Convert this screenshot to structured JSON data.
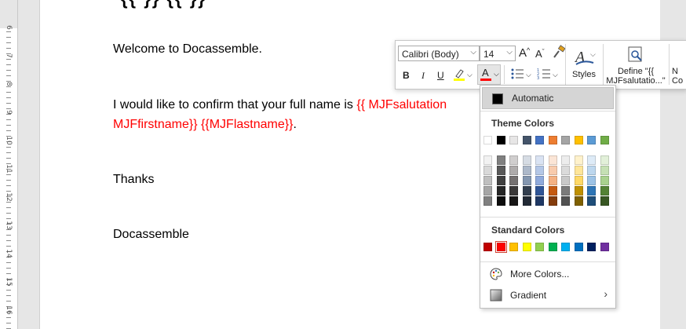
{
  "document": {
    "top_clipped": "{{ }} {{ }}",
    "line1": "Welcome to Docassemble.",
    "line2_plain": "I would like to confirm that your full name is ",
    "line2_red": "{{ MJFsalutation",
    "line3_red": "MJFfirstname}} {{MJFlastname}}",
    "line3_end": ".",
    "line4": "Thanks",
    "line5": "Docassemble"
  },
  "ruler": {
    "numbers": [
      "6",
      "7",
      "8",
      "9",
      "10",
      "11",
      "12",
      "13",
      "14",
      "15",
      "16"
    ]
  },
  "mini_toolbar": {
    "font_name": "Calibri (Body)",
    "font_size": "14",
    "grow_font": "A",
    "shrink_font": "A",
    "bold": "B",
    "italic": "I",
    "underline": "U",
    "font_color_glyph": "A",
    "styles_label": "Styles",
    "define_label_line1": "Define \"{{",
    "define_label_line2": "MJFsalutatio...\"",
    "partial_label_line1": "N",
    "partial_label_line2": "Co"
  },
  "color_menu": {
    "automatic": "Automatic",
    "theme_header": "Theme Colors",
    "standard_header": "Standard Colors",
    "more_colors": "More Colors...",
    "gradient": "Gradient",
    "theme_top": [
      "#ffffff",
      "#000000",
      "#e7e6e6",
      "#44546a",
      "#4472c4",
      "#ed7d31",
      "#a5a5a5",
      "#ffc000",
      "#5b9bd5",
      "#70ad47"
    ],
    "theme_shades": [
      [
        "#f2f2f2",
        "#d9d9d9",
        "#bfbfbf",
        "#a6a6a6",
        "#808080"
      ],
      [
        "#808080",
        "#595959",
        "#404040",
        "#262626",
        "#0d0d0d"
      ],
      [
        "#d0cece",
        "#aeabab",
        "#757171",
        "#3a3838",
        "#171616"
      ],
      [
        "#d6dce4",
        "#adb9ca",
        "#8497b0",
        "#333f4f",
        "#222a35"
      ],
      [
        "#dae3f3",
        "#b4c7e7",
        "#8faadc",
        "#2f5597",
        "#1f3864"
      ],
      [
        "#fbe5d6",
        "#f8cbad",
        "#f4b183",
        "#c55a11",
        "#843c0c"
      ],
      [
        "#ededed",
        "#dbdbdb",
        "#c9c9c9",
        "#7b7b7b",
        "#525252"
      ],
      [
        "#fff2cc",
        "#ffe699",
        "#ffd966",
        "#bf9000",
        "#7f6000"
      ],
      [
        "#deebf7",
        "#bdd7ee",
        "#9dc3e6",
        "#2e75b6",
        "#1f4e79"
      ],
      [
        "#e2f0d9",
        "#c5e0b4",
        "#a9d18e",
        "#548235",
        "#385723"
      ]
    ],
    "standard": [
      "#c00000",
      "#ff0000",
      "#ffc000",
      "#ffff00",
      "#92d050",
      "#00b050",
      "#00b0f0",
      "#0070c0",
      "#002060",
      "#7030a0"
    ],
    "selected_standard_index": 1
  },
  "colors": {
    "field_red": "#ff0000",
    "font_color_bar": "#ff0000",
    "highlight_bar": "#ffff00"
  }
}
